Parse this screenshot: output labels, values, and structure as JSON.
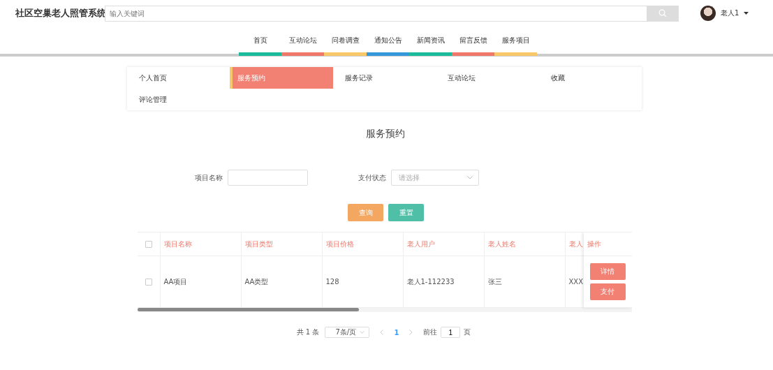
{
  "header": {
    "title": "社区空巢老人照管系统",
    "search": {
      "placeholder": "输入关键词"
    },
    "user": {
      "name": "老人1"
    }
  },
  "nav": [
    {
      "label": "首页",
      "color": "#1abc9c"
    },
    {
      "label": "互动论坛",
      "color": "#f0786a"
    },
    {
      "label": "问卷调查",
      "color": "#f9c868"
    },
    {
      "label": "通知公告",
      "color": "#3498db"
    },
    {
      "label": "新闻资讯",
      "color": "#1abc9c"
    },
    {
      "label": "留言反馈",
      "color": "#f0786a"
    },
    {
      "label": "服务项目",
      "color": "#f9c868"
    }
  ],
  "side_menu": [
    {
      "label": "个人首页",
      "selected": false
    },
    {
      "label": "服务预约",
      "selected": true
    },
    {
      "label": "服务记录",
      "selected": false
    },
    {
      "label": "互动论坛",
      "selected": false
    },
    {
      "label": "收藏",
      "selected": false
    },
    {
      "label": "评论管理",
      "selected": false
    }
  ],
  "page_title": "服务预约",
  "filters": [
    {
      "label": "项目名称",
      "kind": "input"
    },
    {
      "label": "支付状态",
      "kind": "select",
      "placeholder": "请选择"
    }
  ],
  "buttons": [
    {
      "label": "查询",
      "kind": "query"
    },
    {
      "label": "重置",
      "kind": "reset"
    }
  ],
  "table": {
    "all_checked": false,
    "columns": [
      "项目名称",
      "项目类型",
      "项目价格",
      "老人用户",
      "老人姓名",
      "老人"
    ],
    "action_column": "操作",
    "rows": [
      {
        "checked": false,
        "cells": [
          "AA项目",
          "AA类型",
          "128",
          "老人1-112233",
          "张三",
          "XXX"
        ],
        "actions": [
          "详情",
          "支付"
        ]
      }
    ]
  },
  "pagination": {
    "total": "共 1 条",
    "page_size": "7条/页",
    "pages": [
      {
        "label": "1",
        "selected": true
      }
    ],
    "goto_label": "前往",
    "goto_value": "1",
    "goto_suffix": "页"
  }
}
